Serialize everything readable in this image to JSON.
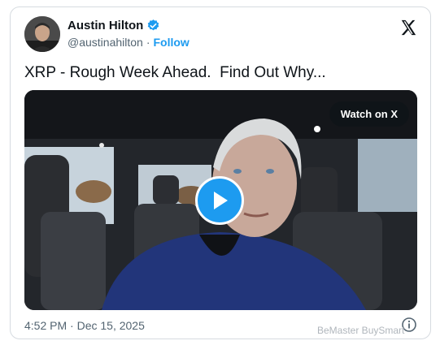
{
  "author": {
    "display_name": "Austin Hilton",
    "handle": "@austinahilton",
    "separator": "·",
    "follow_label": "Follow"
  },
  "post": {
    "text": "XRP - Rough Week Ahead.  Find Out Why...",
    "watch_label": "Watch on X"
  },
  "meta": {
    "timestamp": "4:52 PM · Dec 15, 2025"
  },
  "watermark": {
    "text": "BeMaster BuySmart"
  },
  "colors": {
    "accent": "#1d9bf0",
    "text": "#0f1419",
    "muted": "#536471"
  },
  "icons": [
    "verified-badge-icon",
    "x-logo-icon",
    "play-icon",
    "info-icon"
  ]
}
